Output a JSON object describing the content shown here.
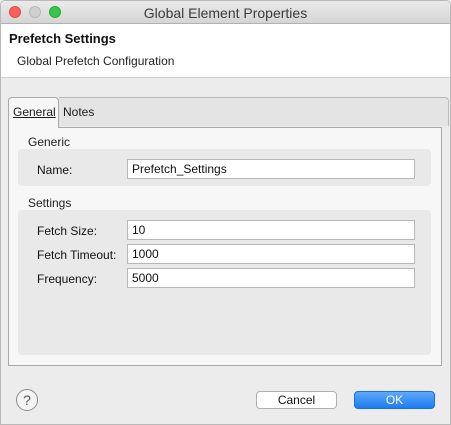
{
  "window": {
    "title": "Global Element Properties"
  },
  "header": {
    "title": "Prefetch Settings",
    "subtitle": "Global Prefetch Configuration"
  },
  "tabs": [
    {
      "label": "General",
      "active": true
    },
    {
      "label": "Notes",
      "active": false
    }
  ],
  "generic": {
    "section_label": "Generic",
    "name_label": "Name:",
    "name_value": "Prefetch_Settings"
  },
  "settings": {
    "section_label": "Settings",
    "fetch_size_label": "Fetch Size:",
    "fetch_size_value": "10",
    "fetch_timeout_label": "Fetch Timeout:",
    "fetch_timeout_value": "1000",
    "frequency_label": "Frequency:",
    "frequency_value": "5000"
  },
  "footer": {
    "help_glyph": "?",
    "cancel_label": "Cancel",
    "ok_label": "OK"
  },
  "colors": {
    "ok_button": "#1d7cf2",
    "close_light": "#fc605c",
    "maximize_light": "#34c84a"
  }
}
